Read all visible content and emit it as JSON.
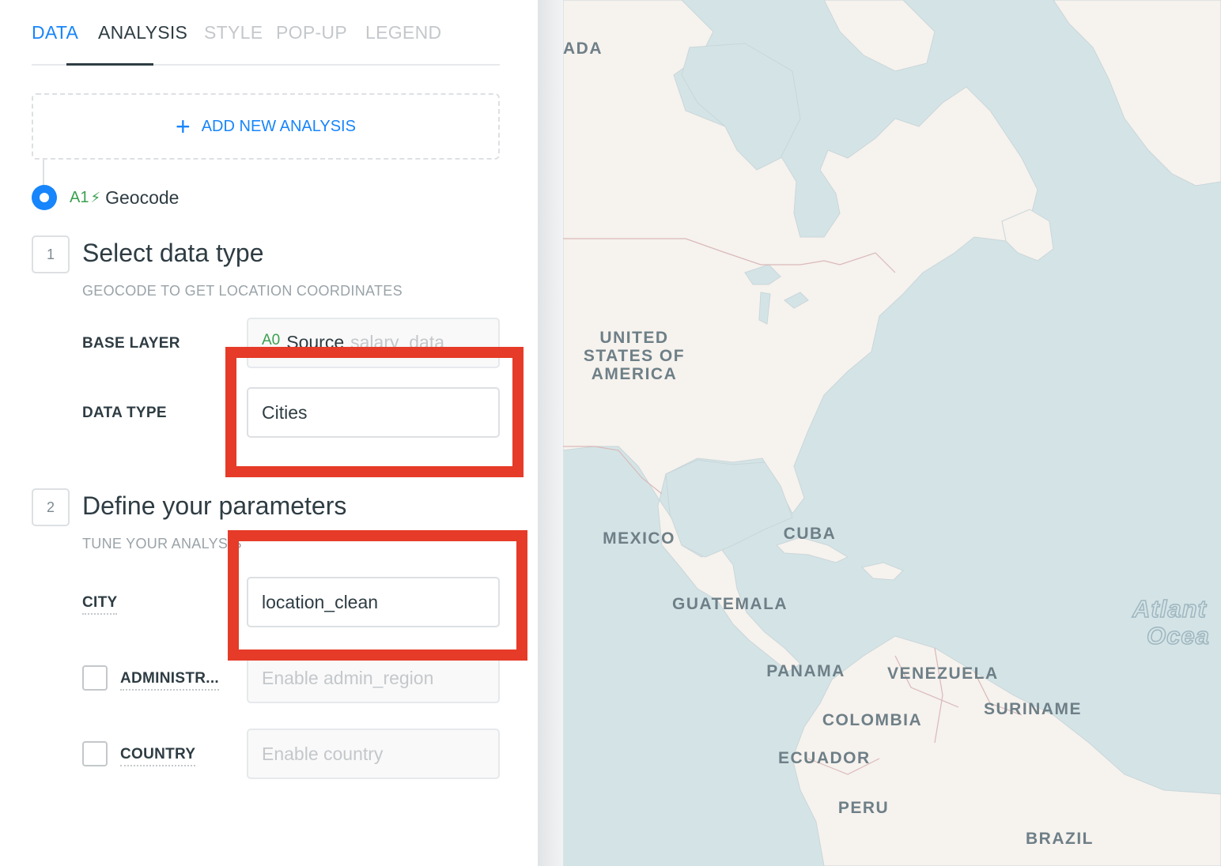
{
  "tabs": [
    {
      "label": "DATA",
      "state": "done"
    },
    {
      "label": "ANALYSIS",
      "state": "active"
    },
    {
      "label": "STYLE",
      "state": "inactive"
    },
    {
      "label": "POP-UP",
      "state": "inactive"
    },
    {
      "label": "LEGEND",
      "state": "inactive"
    }
  ],
  "add_analysis": {
    "icon": "plus-icon",
    "label": "ADD NEW ANALYSIS"
  },
  "analysis_node": {
    "id": "A1",
    "icon": "lightning-icon",
    "title": "Geocode"
  },
  "step1": {
    "number": "1",
    "title": "Select data type",
    "subtitle": "GEOCODE TO GET LOCATION COORDINATES",
    "base_layer": {
      "label": "BASE LAYER",
      "source_id": "A0",
      "source_name": "Source",
      "table": "salary_data"
    },
    "data_type": {
      "label": "DATA TYPE",
      "value": "Cities"
    }
  },
  "step2": {
    "number": "2",
    "title": "Define your parameters",
    "subtitle": "TUNE YOUR ANALYSIS",
    "city": {
      "label": "CITY",
      "value": "location_clean"
    },
    "admin": {
      "label": "ADMINISTR...",
      "placeholder": "Enable admin_region",
      "checked": false
    },
    "country": {
      "label": "COUNTRY",
      "placeholder": "Enable country",
      "checked": false
    }
  },
  "map": {
    "labels": {
      "canada": "ADA",
      "usa": "UNITED STATES OF AMERICA",
      "mexico": "MEXICO",
      "cuba": "CUBA",
      "guatemala": "GUATEMALA",
      "panama": "PANAMA",
      "venezuela": "VENEZUELA",
      "suriname": "SURINAME",
      "colombia": "COLOMBIA",
      "ecuador": "ECUADOR",
      "peru": "PERU",
      "brazil": "BRAZIL",
      "ocean_line1": "Atlant",
      "ocean_line2": "Ocea"
    }
  },
  "colors": {
    "accent": "#1785fb",
    "source_green": "#3aa04f",
    "highlight_red": "#e53b28",
    "water": "#d4e4e6",
    "land": "#f6f2ee"
  }
}
